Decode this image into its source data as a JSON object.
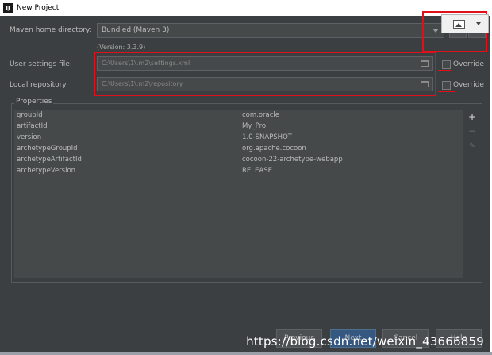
{
  "window": {
    "title": "New Project",
    "app_icon": "IJ"
  },
  "maven": {
    "home_label": "Maven home directory:",
    "home_value": "Bundled (Maven 3)",
    "version": "(Version: 3.3.9)",
    "user_settings_label": "User settings file:",
    "user_settings_value": "C:\\Users\\1\\.m2\\settings.xml",
    "local_repo_label": "Local repository:",
    "local_repo_value": "C:\\Users\\1\\.m2\\repository",
    "override_label": "Override"
  },
  "properties": {
    "title": "Properties",
    "rows": [
      {
        "key": "groupId",
        "value": "com.oracle"
      },
      {
        "key": "artifactId",
        "value": "My_Pro"
      },
      {
        "key": "version",
        "value": "1.0-SNAPSHOT"
      },
      {
        "key": "archetypeGroupId",
        "value": "org.apache.cocoon"
      },
      {
        "key": "archetypeArtifactId",
        "value": "cocoon-22-archetype-webapp"
      },
      {
        "key": "archetypeVersion",
        "value": "RELEASE"
      }
    ]
  },
  "buttons": {
    "previous": "Previous",
    "next": "Next",
    "cancel": "Cancel",
    "help": "Help"
  },
  "watermark": "https://blog.csdn.net/weixin_43666859",
  "colors": {
    "accent_red": "#e0101a",
    "dialog_bg": "#3c3f41",
    "primary_button": "#365880"
  }
}
